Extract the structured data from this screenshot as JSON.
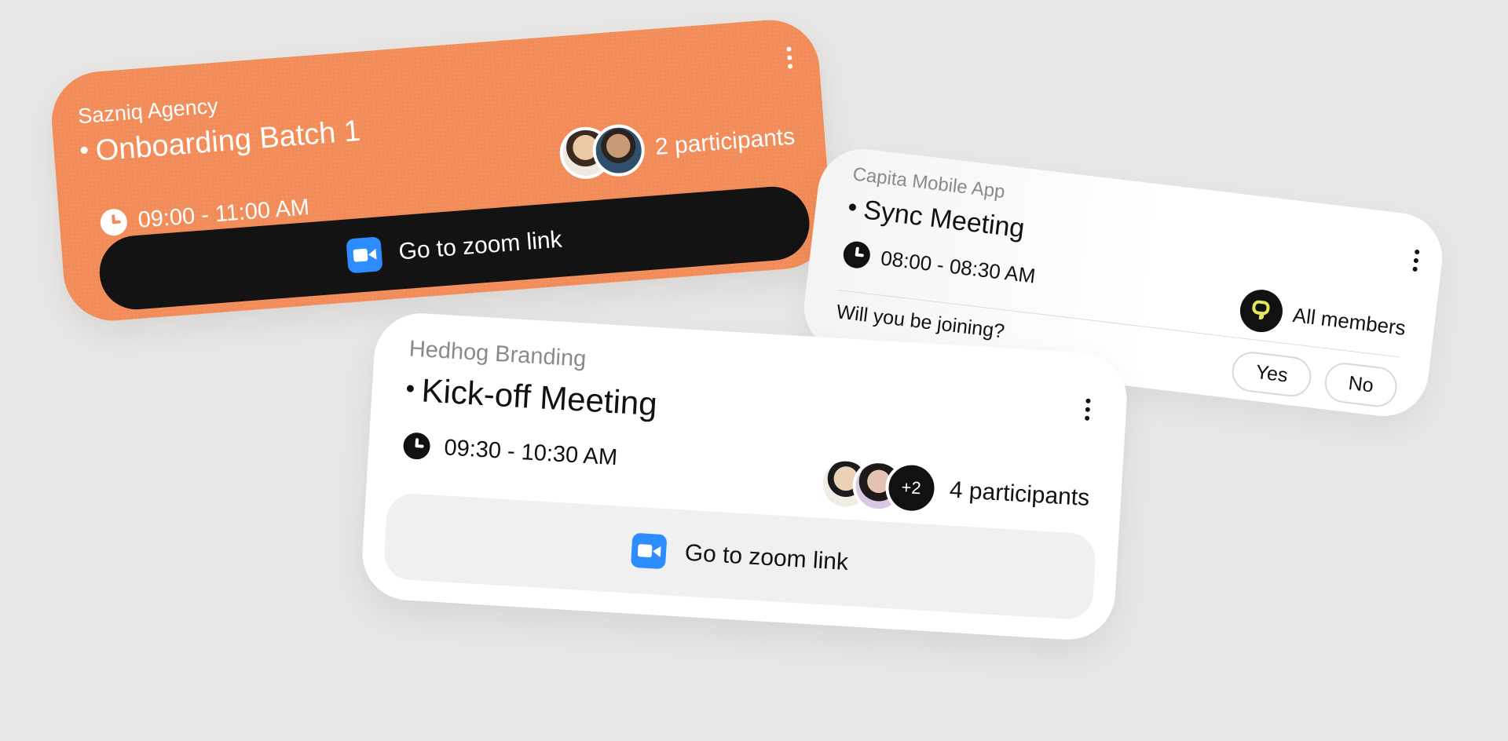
{
  "cards": {
    "onboarding": {
      "org": "Sazniq Agency",
      "title": "Onboarding Batch 1",
      "time": "09:00 - 11:00 AM",
      "participants": "2 participants",
      "zoom_label": "Go to zoom link",
      "accent_color": "#f28b57"
    },
    "sync": {
      "org": "Capita Mobile App",
      "title": "Sync Meeting",
      "time": "08:00 - 08:30 AM",
      "members": "All members",
      "question": "Will you be joining?",
      "yes_label": "Yes",
      "no_label": "No"
    },
    "kickoff": {
      "org": "Hedhog Branding",
      "title": "Kick-off Meeting",
      "time": "09:30 - 10:30 AM",
      "more_count": "+2",
      "participants": "4 participants",
      "zoom_label": "Go to zoom link"
    }
  },
  "icons": [
    "clock-icon",
    "zoom-icon",
    "more-vertical-icon",
    "avatar",
    "team-logo-icon"
  ],
  "colors": {
    "background": "#e8e7e5",
    "zoom_blue": "#2d8cff",
    "dark": "#131313"
  }
}
